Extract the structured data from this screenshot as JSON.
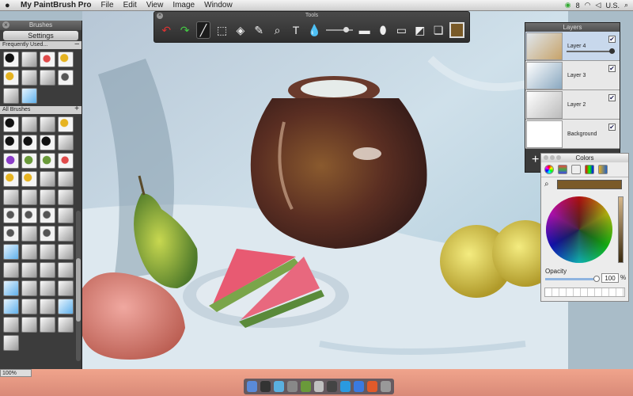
{
  "menubar": {
    "app_name": "My PaintBrush Pro",
    "menus": [
      "File",
      "Edit",
      "View",
      "Image",
      "Window"
    ],
    "status_right": [
      "8",
      "U.S."
    ]
  },
  "brushes_panel": {
    "title": "Brushes",
    "settings_label": "Settings",
    "frequent_label": "Frequently Used...",
    "all_label": "All Brushes",
    "frequent_tiles": [
      "k",
      "s",
      "r",
      "y",
      "y",
      "s",
      "s",
      "d",
      "s",
      "b"
    ],
    "all_tiles": [
      "k",
      "s",
      "s",
      "y",
      "k",
      "k",
      "k",
      "s",
      "p",
      "g",
      "g",
      "r",
      "y",
      "y",
      "s",
      "s",
      "s",
      "s",
      "s",
      "s",
      "d",
      "d",
      "d",
      "s",
      "d",
      "s",
      "d",
      "s",
      "b",
      "s",
      "s",
      "s",
      "s",
      "s",
      "s",
      "s",
      "b",
      "s",
      "s",
      "s",
      "b",
      "s",
      "s",
      "b",
      "s",
      "s",
      "s",
      "s",
      "s"
    ]
  },
  "tools": {
    "title": "Tools",
    "items": [
      {
        "name": "undo-icon",
        "glyph": "↶",
        "cls": "undo"
      },
      {
        "name": "redo-icon",
        "glyph": "↷",
        "cls": "redo"
      },
      {
        "name": "brush-tool",
        "glyph": "╱",
        "cls": "active"
      },
      {
        "name": "select-tool",
        "glyph": "⬚",
        "cls": ""
      },
      {
        "name": "fill-tool",
        "glyph": "◈",
        "cls": ""
      },
      {
        "name": "eyedropper-tool",
        "glyph": "✎",
        "cls": ""
      },
      {
        "name": "zoom-tool",
        "glyph": "⌕",
        "cls": ""
      },
      {
        "name": "text-tool",
        "glyph": "T",
        "cls": ""
      },
      {
        "name": "blur-tool",
        "glyph": "💧",
        "cls": ""
      }
    ]
  },
  "layers": {
    "title": "Layers",
    "items": [
      {
        "name": "Layer 4",
        "selected": true,
        "visible": "✔"
      },
      {
        "name": "Layer 3",
        "selected": false,
        "visible": "✔"
      },
      {
        "name": "Layer 2",
        "selected": false,
        "visible": "✔"
      },
      {
        "name": "Background",
        "selected": false,
        "visible": "✔"
      }
    ],
    "add_label": "+"
  },
  "colors": {
    "title": "Colors",
    "current": "#7a5a28",
    "opacity_label": "Opacity",
    "opacity_value": "100",
    "opacity_unit": "%"
  },
  "status": {
    "zoom": "100%"
  }
}
